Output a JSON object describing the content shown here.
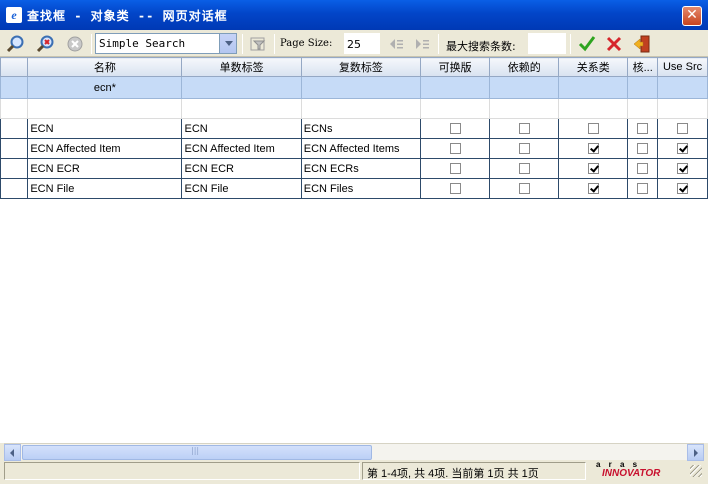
{
  "window": {
    "title": "查找框 - 对象类 -- 网页对话框",
    "app_icon_glyph": "e",
    "close_glyph": "✕"
  },
  "toolbar": {
    "search_mode": "Simple Search",
    "page_size_label": "Page Size:",
    "page_size": "25",
    "max_results_label": "最大搜索条数:",
    "max_results": "",
    "icons": [
      "search-icon",
      "clear-search-icon",
      "stop-icon",
      "filter-icon",
      "prev-page-icon",
      "next-page-icon",
      "ok-checkmark-icon",
      "cancel-x-icon",
      "exit-icon"
    ],
    "colors": {
      "ok": "#2ea41f",
      "cancel": "#d6262c"
    }
  },
  "grid": {
    "columns": [
      "",
      "名称",
      "单数标签",
      "复数标签",
      "可换版",
      "依赖的",
      "关系类",
      "核...",
      "Use Src"
    ],
    "filter": [
      "",
      "ecn*",
      "",
      "",
      "",
      "",
      "",
      "",
      ""
    ],
    "rows": [
      {
        "name": "ECN",
        "singular": "ECN",
        "plural": "ECNs",
        "versionable": false,
        "dependent": false,
        "relationship": false,
        "core": false,
        "use_src": false
      },
      {
        "name": "ECN Affected Item",
        "singular": "ECN Affected Item",
        "plural": "ECN Affected Items",
        "versionable": false,
        "dependent": false,
        "relationship": true,
        "core": false,
        "use_src": true
      },
      {
        "name": "ECN ECR",
        "singular": "ECN ECR",
        "plural": "ECN ECRs",
        "versionable": false,
        "dependent": false,
        "relationship": true,
        "core": false,
        "use_src": true
      },
      {
        "name": "ECN File",
        "singular": "ECN File",
        "plural": "ECN Files",
        "versionable": false,
        "dependent": false,
        "relationship": true,
        "core": false,
        "use_src": true
      }
    ]
  },
  "status": {
    "text": "第 1-4项, 共 4项. 当前第 1页 共 1页",
    "logo_top": "a r a s",
    "logo_bottom": "INNOVATOR"
  }
}
